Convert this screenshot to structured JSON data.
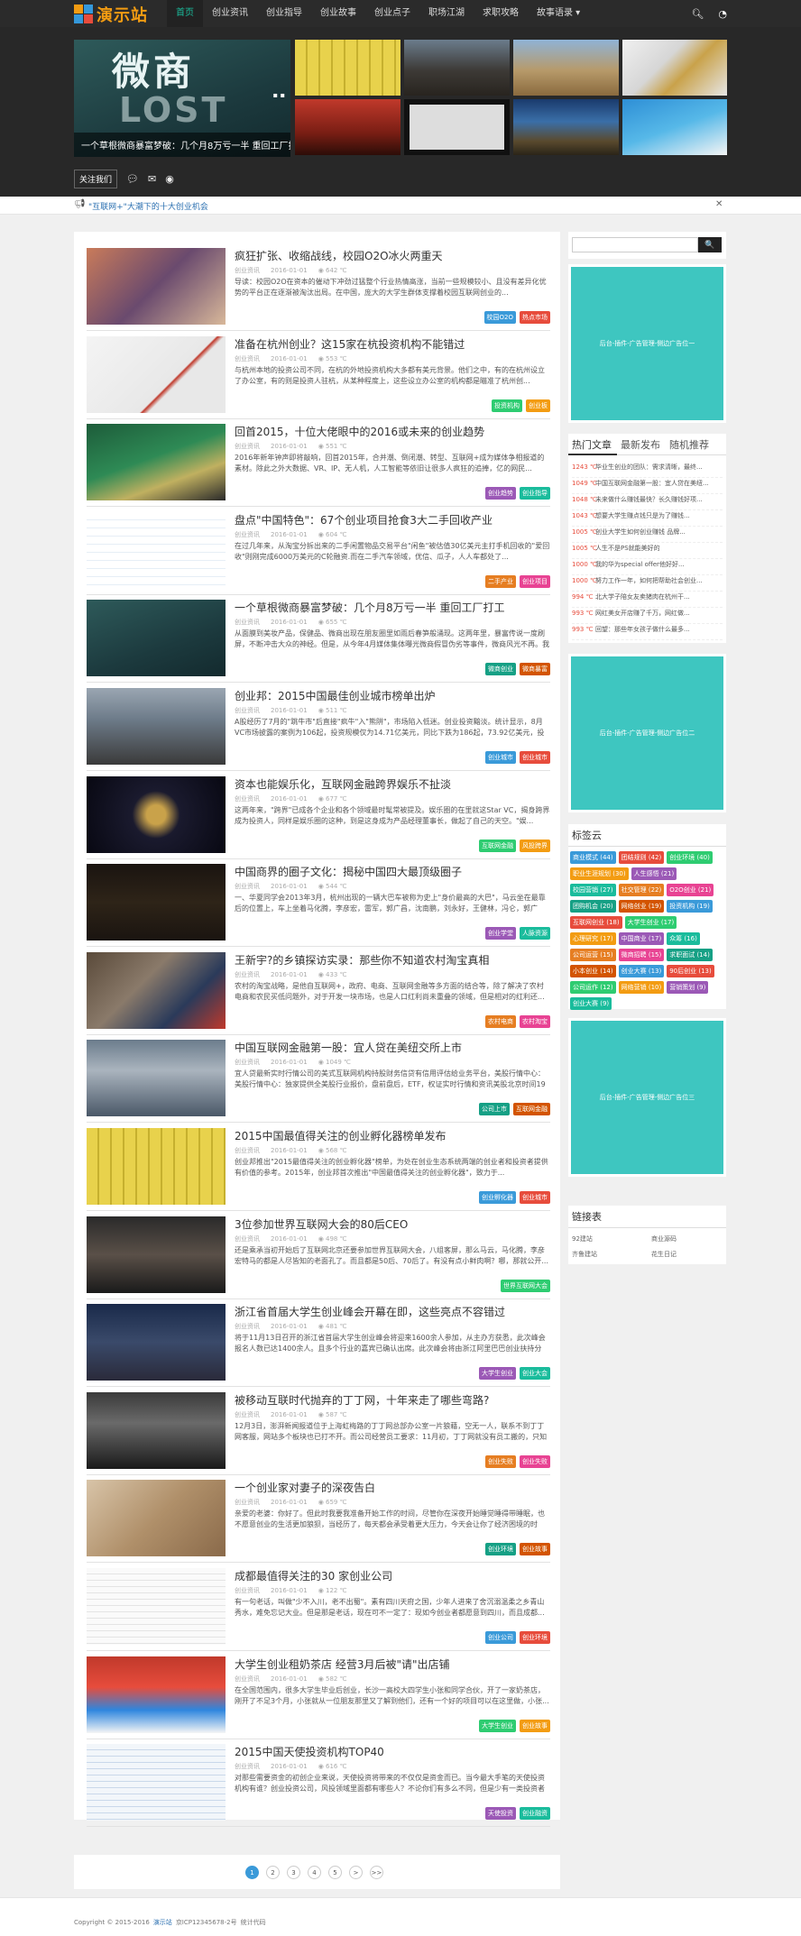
{
  "site": {
    "logo": "演示站"
  },
  "nav": [
    "首页",
    "创业资讯",
    "创业指导",
    "创业故事",
    "创业点子",
    "职场江湖",
    "求职攻略",
    "故事语录 ▾"
  ],
  "hero": {
    "big_text": "微商",
    "big_text2": "LOST",
    "caption": "一个草根微商暴富梦破：几个月8万亏一半 重回工厂打工",
    "dots": "▪ ▪"
  },
  "follow": "关注我们",
  "notice": "\"互联网+\"大潮下的十大创业机会",
  "articles": [
    {
      "title": "疯狂扩张、收缩战线，校园O2O冰火两重天",
      "cat": "创业资讯",
      "date": "2016-01-01",
      "views": "◉ 642 ℃",
      "excerpt": "导读：校园O2O在资本的催动下冲劲过猛整个行业热情高涨，当前一些规模较小、且没有差异化优势的平台正在逐渐被淘汰出局。在中国，庞大的大学生群体支撑着校园互联网创业的...",
      "tags": [
        "校园O2O",
        "热点市场"
      ]
    },
    {
      "title": "准备在杭州创业？这15家在杭投资机构不能错过",
      "cat": "创业资讯",
      "date": "2016-01-01",
      "views": "◉ 553 ℃",
      "excerpt": "与杭州本地的投资公司不同，在杭的外地投资机构大多都有美元背景。他们之中，有的在杭州设立了办公室，有的则是投资人驻杭，从某种程度上，这些设立办公室的机构都是瞄准了杭州创...",
      "tags": [
        "投资机构",
        "创业板"
      ]
    },
    {
      "title": "回首2015，十位大佬眼中的2016或未来的创业趋势",
      "cat": "创业资讯",
      "date": "2016-01-01",
      "views": "◉ 551 ℃",
      "excerpt": "2016年新年钟声即将敲响，回首2015年，合并潮、倒闭潮、转型、互联网+成为媒体争相报道的素材。除此之外大数据、VR、IP、无人机，人工智能等依旧让很多人疯狂的追捧，亿的网民...",
      "tags": [
        "创业趋势",
        "创业指导"
      ]
    },
    {
      "title": "盘点\"中国特色\"：67个创业项目抢食3大二手回收产业",
      "cat": "创业资讯",
      "date": "2016-01-01",
      "views": "◉ 604 ℃",
      "excerpt": "在过几年来，从淘宝分拆出来的二手闲置物品交易平台\"闲鱼\"被估值30亿美元主打手机回收的\"爱回收\"则刚完成6000万美元的C轮融资.而在二手汽车领域，优信、瓜子，人人车都处了...",
      "tags": [
        "二手产业",
        "创业项目"
      ]
    },
    {
      "title": "一个草根微商暴富梦破：几个月8万亏一半 重回工厂打工",
      "cat": "创业资讯",
      "date": "2016-01-01",
      "views": "◉ 655 ℃",
      "excerpt": "从面膜到美妆产品，保健品、微商出现在朋友圈里如雨后春笋般涌现。这两年里，暴富传说一度刷屏，不断冲击大众的神经。但是，从今年4月媒体集体曝光微商假冒伪劣等事件，微商风光不再。我在...",
      "tags": [
        "微商创业",
        "微商暴富"
      ]
    },
    {
      "title": "创业邦：2015中国最佳创业城市榜单出炉",
      "cat": "创业资讯",
      "date": "2016-01-01",
      "views": "◉ 511 ℃",
      "excerpt": "A股经历了7月的\"跳牛市\"后直接\"疯牛\"入\"熊阱\"，市场陷入低迷。创业投资黯淡。统计显示，8月VC市场披露的案例为106起，投资规模仅为14.71亿美元，同比下跌为186起，73.92亿美元，投资...",
      "tags": [
        "创业城市",
        "创业城市"
      ]
    },
    {
      "title": "资本也能娱乐化，互联网金融跨界娱乐不扯淡",
      "cat": "创业资讯",
      "date": "2016-01-01",
      "views": "◉ 677 ℃",
      "excerpt": "这两年来，\"跨界\"已成各个企业和各个领域最时髦常被提及。娱乐圈的在里就这Star VC，揭身跨界成为投资人，同样是娱乐圈的这种，到是这身成为产品经理董事长，做起了自己的天空。\"娱...",
      "tags": [
        "互联网金融",
        "风投跨界"
      ]
    },
    {
      "title": "中国商界的圈子文化：揭秘中国四大最顶级圈子",
      "cat": "创业资讯",
      "date": "2016-01-01",
      "views": "◉ 544 ℃",
      "excerpt": "一、华夏同学会2013年3月，杭州出现的一辆大巴车被称为史上\"身价最高的大巴\"，马云坐在最靠后的位置上，车上坐着马化腾，李彦宏，雷军，郭广昌，沈南鹏，刘永好，王健林，冯仑，郭广昌，李...",
      "tags": [
        "创业学堂",
        "人脉资源"
      ]
    },
    {
      "title": "王新宇?的乡镇探访实录：那些你不知道农村淘宝真相",
      "cat": "创业资讯",
      "date": "2016-01-01",
      "views": "◉ 433 ℃",
      "excerpt": "农村的淘宝战略，是他自互联网+，政府、电商、互联网金融等多方面的结合等，除了解决了农村电商和农民买低问题外，对于开发一块市场，也是人口红利尚未重叠的领域，但是相对的红利还...",
      "tags": [
        "农村电商",
        "农村淘宝"
      ]
    },
    {
      "title": "中国互联网金融第一股：宜人贷在美纽交所上市",
      "cat": "创业资讯",
      "date": "2016-01-01",
      "views": "◉ 1049 ℃",
      "excerpt": "宜人贷最新实时行情公司的美式互联网机构持股财务信贷有信用评估给业务平台，美股行情中心：美股行情中心：独家提供全美股行业报价，盘前盘后，ETF，权证实时行情和资讯美股北京时间19日凌...",
      "tags": [
        "公司上市",
        "互联网金融"
      ]
    },
    {
      "title": "2015中国最值得关注的创业孵化器榜单发布",
      "cat": "创业资讯",
      "date": "2016-01-01",
      "views": "◉ 568 ℃",
      "excerpt": "创业邦推出\"2015最值得关注的创业孵化器\"榜单，为处在创业生态系统两端的创业者和投资者提供有价值的参考。2015年，创业邦首次推出\"中国最值得关注的创业孵化器\"，致力于...",
      "tags": [
        "创业孵化器",
        "创业城市"
      ]
    },
    {
      "title": "3位参加世界互联网大会的80后CEO",
      "cat": "创业资讯",
      "date": "2016-01-01",
      "views": "◉ 498 ℃",
      "excerpt": "还是乘承当初开始后了互联网北京还要参加世界互联网大会，八组客屏，那么马云，马化腾，李彦宏特马的都是人尽皆知的老面孔了。而且都是50后、70后了。有没有点小鲜肉啊？哪，那就公开...",
      "tags": [
        "世界互联网大会"
      ]
    },
    {
      "title": "浙江省首届大学生创业峰会开幕在即，这些亮点不容错过",
      "cat": "创业资讯",
      "date": "2016-01-01",
      "views": "◉ 481 ℃",
      "excerpt": "将于11月13日召开的浙江省首届大学生创业峰会将迎来1600余人参加，从主办方获悉，此次峰会报名人数已达1400余人。且多个行业的嘉宾已确认出席。此次峰会将由浙江阿里巴巴创业扶持分会...",
      "tags": [
        "大学生创业",
        "创业大会"
      ]
    },
    {
      "title": "被移动互联时代抛弃的丁丁网，十年来走了哪些弯路?",
      "cat": "创业资讯",
      "date": "2016-01-01",
      "views": "◉ 587 ℃",
      "excerpt": "12月3日，澎湃新闻报道位于上海虹梅路的丁丁网总部办公室一片狼藉，空无一人，联系不到丁丁网客服，网站多个板块也已打不开。而公司经营员工要求：11月初，丁丁网就没有员工搬的，只知道...",
      "tags": [
        "创业失败",
        "创业失败"
      ]
    },
    {
      "title": "一个创业家对妻子的深夜告白",
      "cat": "创业资讯",
      "date": "2016-01-01",
      "views": "◉ 659 ℃",
      "excerpt": "亲爱的老婆：你好了。但此时我要我准备开始工作的时间，尽管你在深夜开始睡觉睡得带睡眠，也不愿意创业的生活更加狼狈，当经历了，每天都会承受着更大压力，今天会让你了经济困境的时候，又...",
      "tags": [
        "创业环境",
        "创业故事"
      ]
    },
    {
      "title": "成都最值得关注的30 家创业公司",
      "cat": "创业资讯",
      "date": "2016-01-01",
      "views": "◉ 122 ℃",
      "excerpt": "有一句老话，叫做\"少不入川，老不出蜀\"。素有四川天府之国，少年人进来了舍沉溺温柔之乡青山秀水，难免忘记大业。但是那是老话，现在可不一定了：现如今创业者都愿意到四川，而且成都...",
      "tags": [
        "创业公司",
        "创业环境"
      ]
    },
    {
      "title": "大学生创业租奶茶店 经营3月后被\"请\"出店铺",
      "cat": "创业资讯",
      "date": "2016-01-01",
      "views": "◉ 582 ℃",
      "excerpt": "在全国范围内，很多大学生毕业后创业，长沙一高校大四学生小张和同学合伙，开了一家奶茶店，刚开了不足3个月，小张就从一位朋友那里又了解到他们，还有一个好的项目可以在这里做，小张...",
      "tags": [
        "大学生创业",
        "创业故事"
      ]
    },
    {
      "title": "2015中国天使投资机构TOP40",
      "cat": "创业资讯",
      "date": "2016-01-01",
      "views": "◉ 616 ℃",
      "excerpt": "对那些需要资金的初创企业来说，天使投资将带来的不仅仅是资金而已。当今最大手笔的天使投资机构有谁？创业投资公司，风投领域里面都有哪些人？不论你们有多么不同，但是少有一类投资者的目光...",
      "tags": [
        "天使投资",
        "创业融资"
      ]
    }
  ],
  "pager": [
    "1",
    "2",
    "3",
    "4",
    "5",
    ">",
    ">>"
  ],
  "sidebar": {
    "search": {
      "placeholder": "",
      "button": "🔍"
    },
    "ad1": "后台-插件-广告管理-侧边广告位一",
    "ad2": "后台-插件-广告管理-侧边广告位二",
    "ad3": "后台-插件-广告管理-侧边广告位三",
    "tabs": [
      "热门文章",
      "最新发布",
      "随机推荐"
    ],
    "hot": [
      {
        "count": "1243 ℃",
        "text": "毕业生创业的团队：需求清晰，最终..."
      },
      {
        "count": "1049 ℃",
        "text": "中国互联网金融第一股：宜人贷在美纽..."
      },
      {
        "count": "1048 ℃",
        "text": "未来做什么赚钱最快？长久赚钱好项..."
      },
      {
        "count": "1043 ℃",
        "text": "想要大学生赚点钱只是为了赚钱..."
      },
      {
        "count": "1005 ℃",
        "text": "创业大学生如何创业赚钱 品牌..."
      },
      {
        "count": "1005 ℃",
        "text": "人生不是PS就能美好的"
      },
      {
        "count": "1000 ℃",
        "text": "我的华为special offer他好好..."
      },
      {
        "count": "1000 ℃",
        "text": "努力工作一年，如何把帮助社会创业..."
      },
      {
        "count": "994 ℃",
        "text": "北大学子陪女友卖猪肉在杭州干..."
      },
      {
        "count": "993 ℃",
        "text": "网红美女开店赚了千万，网红做..."
      },
      {
        "count": "993 ℃",
        "text": "回望：那些年女孩子做什么最多..."
      }
    ],
    "tagcloud_title": "标签云",
    "cloud": [
      "商业模式 (44)",
      "团结规则 (42)",
      "创业环境 (40)",
      "职业生涯规划 (30)",
      "人生感悟 (21)",
      "校园营销 (27)",
      "社交管理 (22)",
      "O2O创业 (21)",
      "团购机会 (20)",
      "网络创业 (19)",
      "投资机构 (19)",
      "互联网创业 (18)",
      "大学生创业 (17)",
      "心理研究 (17)",
      "中国商业 (17)",
      "众筹 (16)",
      "公司运营 (15)",
      "微商招聘 (15)",
      "求职面试 (14)",
      "小本创业 (14)",
      "创业大赛 (13)",
      "90后创业 (13)",
      "公司运作 (12)",
      "网络营销 (10)",
      "营销策划 (9)",
      "创业大赛 (9)"
    ],
    "links_title": "链接表",
    "links": [
      "92建站",
      "商业源码",
      "齐鲁建站",
      "花生日记"
    ]
  },
  "footer": {
    "copyright": "Copyright © 2015-2016",
    "site": "演示站",
    "icp": "京ICP12345678-2号",
    "stats": "统计代码"
  },
  "colors": {
    "accent": "#1abc9c",
    "ad": "#3ec6c0",
    "topbar": "#2b2b2b"
  }
}
